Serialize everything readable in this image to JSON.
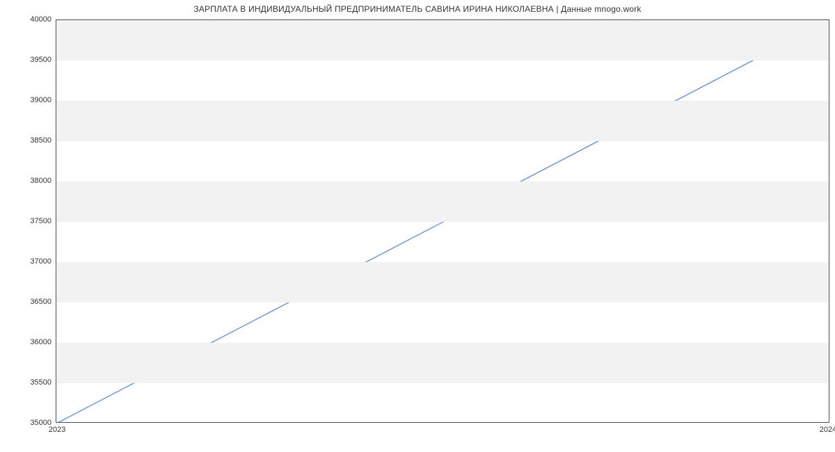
{
  "chart_data": {
    "type": "line",
    "title": "ЗАРПЛАТА В ИНДИВИДУАЛЬНЫЙ ПРЕДПРИНИМАТЕЛЬ САВИНА ИРИНА НИКОЛАЕВНА | Данные mnogo.work",
    "x": [
      2023,
      2024
    ],
    "values": [
      35000,
      40000
    ],
    "xlabel": "",
    "ylabel": "",
    "xlim": [
      2023,
      2024
    ],
    "ylim": [
      35000,
      40000
    ],
    "y_ticks": [
      35000,
      35500,
      36000,
      36500,
      37000,
      37500,
      38000,
      38500,
      39000,
      39500,
      40000
    ],
    "x_ticks": [
      2023,
      2024
    ],
    "line_color": "#6a8fd8",
    "grid_band_color": "#f2f2f2"
  }
}
